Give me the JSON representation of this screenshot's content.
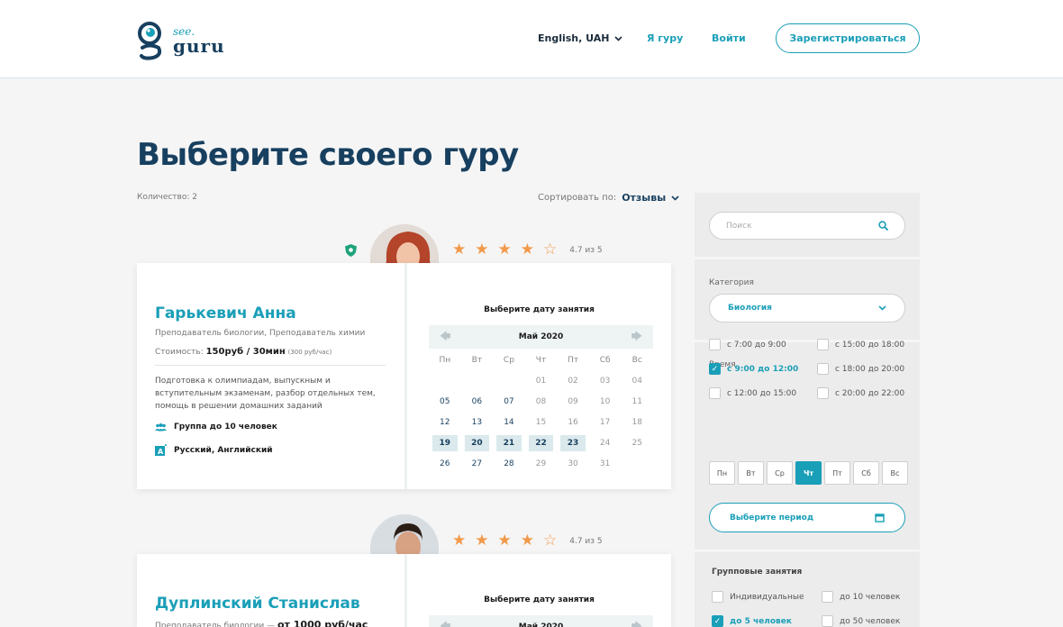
{
  "header": {
    "logo_top": "see.",
    "logo_bottom": "guru",
    "language": "English, UAH",
    "i_am_guru": "Я гуру",
    "login": "Войти",
    "register": "Зарегистрироваться"
  },
  "page": {
    "title": "Выберите своего гуру",
    "count": "Количество: 2",
    "sort_label": "Сортировать по:",
    "sort_value": "Отзывы"
  },
  "colors": {
    "accent": "#1a9fb8",
    "dark": "#173f5f",
    "star": "#f2994a"
  },
  "tutors": [
    {
      "name": "Гарькевич Анна",
      "role": "Преподаватель биологии, Преподаватель химии",
      "price_prefix": "Стоимость:",
      "price": "150руб / 30мин",
      "price_note": "(300 руб/час)",
      "description": "Подготовка к олимпиадам, выпускным и вступительным экзаменам, разбор отдельных тем, помощь в решении домашних заданий",
      "group": "Группа до 10 человек",
      "languages": "Русский, Английский",
      "rating": 4.7,
      "rating_text": "4.7 из 5",
      "verified": true
    },
    {
      "name": "Дуплинский Станислав",
      "role": "Преподаватель биологии —",
      "price": "от 1000 руб/час",
      "rating": 4.7,
      "rating_text": "4.7 из 5"
    }
  ],
  "calendar": {
    "title": "Выберите дату занятия",
    "month": "Май 2020",
    "weekdays": [
      "Пн",
      "Вт",
      "Ср",
      "Чт",
      "Пт",
      "Сб",
      "Вс"
    ],
    "rows": [
      [
        "",
        "",
        "",
        "01",
        "02",
        "03",
        "04"
      ],
      [
        "05",
        "06",
        "07",
        "08",
        "09",
        "10",
        "11"
      ],
      [
        "12",
        "13",
        "14",
        "15",
        "16",
        "17",
        "18"
      ],
      [
        "19",
        "20",
        "21",
        "22",
        "23",
        "24",
        "25"
      ],
      [
        "26",
        "27",
        "28",
        "29",
        "30",
        "31",
        ""
      ]
    ],
    "available": [
      "05",
      "06",
      "07",
      "12",
      "13",
      "14",
      "19",
      "20",
      "21",
      "22",
      "23",
      "26",
      "27",
      "28"
    ],
    "highlighted": [
      "19",
      "20",
      "21",
      "22",
      "23"
    ]
  },
  "sidebar": {
    "search_placeholder": "Поиск",
    "category_label": "Категория",
    "category_value": "Биология",
    "time_label": "Время",
    "times": [
      {
        "label": "с 7:00 до 9:00",
        "checked": false
      },
      {
        "label": "с 15:00 до 18:00",
        "checked": false
      },
      {
        "label": "с 9:00 до 12:00",
        "checked": true
      },
      {
        "label": "с 18:00 до 20:00",
        "checked": false
      },
      {
        "label": "с 12:00 до 15:00",
        "checked": false
      },
      {
        "label": "с 20:00 до 22:00",
        "checked": false
      }
    ],
    "days": [
      {
        "label": "Пн",
        "active": false
      },
      {
        "label": "Вт",
        "active": false
      },
      {
        "label": "Ср",
        "active": false
      },
      {
        "label": "Чт",
        "active": true
      },
      {
        "label": "Пт",
        "active": false
      },
      {
        "label": "Сб",
        "active": false
      },
      {
        "label": "Вс",
        "active": false
      }
    ],
    "period_label": "Выберите период",
    "group_heading": "Групповые занятия",
    "group_options": [
      {
        "label": "Индивидуальные",
        "checked": false
      },
      {
        "label": "до 10 человек",
        "checked": false
      },
      {
        "label": "до 5 человек",
        "checked": true
      },
      {
        "label": "до 50 человек",
        "checked": false
      }
    ]
  }
}
